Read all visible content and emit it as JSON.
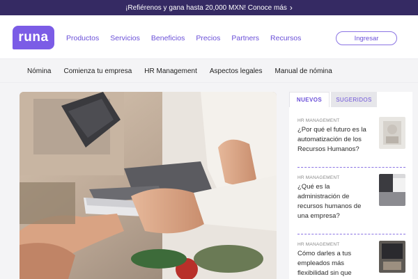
{
  "promo": {
    "text": "¡Refiérenos y gana hasta 20,000 MXN!  Conoce más",
    "arrow": "›"
  },
  "brand": {
    "logo": "runa",
    "accent": "#7b5ce6",
    "promo_bg": "#352a63"
  },
  "nav": {
    "items": [
      "Productos",
      "Servicios",
      "Beneficios",
      "Precios",
      "Partners",
      "Recursos"
    ]
  },
  "login": {
    "label": "Ingresar"
  },
  "subnav": {
    "items": [
      "Nómina",
      "Comienza tu empresa",
      "HR Management",
      "Aspectos legales",
      "Manual de nómina"
    ]
  },
  "sidebar": {
    "tabs": [
      "NUEVOS",
      "SUGERIDOS"
    ],
    "articles": [
      {
        "category": "HR MANAGEMENT",
        "title": "¿Por qué el futuro es la automatización de los Recursos Humanos?"
      },
      {
        "category": "HR MANAGEMENT",
        "title": "¿Qué es la administración de recursos humanos de una empresa?"
      },
      {
        "category": "HR MANAGEMENT",
        "title": "Cómo darles a tus empleados más flexibilidad sin que"
      }
    ]
  }
}
